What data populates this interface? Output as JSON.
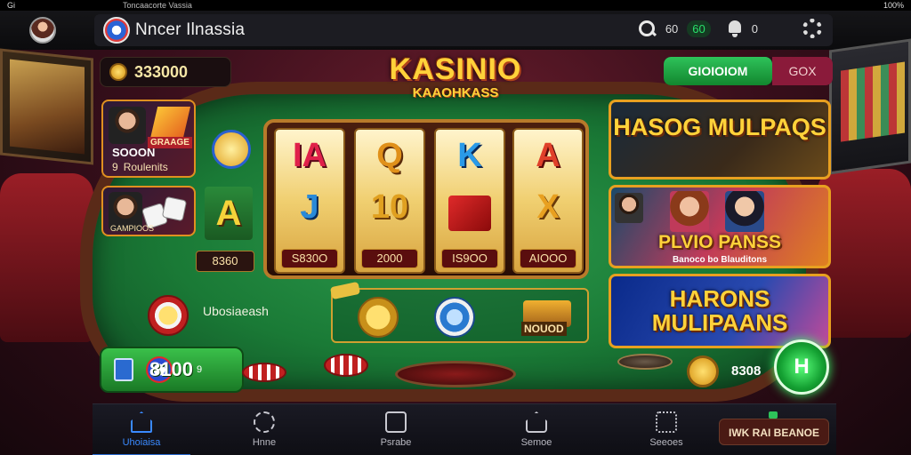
{
  "status_bar": {
    "left": "Gi",
    "center": "Toncaacorte Vassia",
    "right": "100%"
  },
  "header": {
    "title": "Nncer Ilnassia",
    "count_a": "60",
    "count_b": "60",
    "count_c": "0"
  },
  "balance": {
    "value": "333000"
  },
  "logo": {
    "line1": "KASINIO",
    "line2": "KAAOHKASS"
  },
  "tabs": {
    "primary": "GIOIOIOM",
    "secondary": "GOX"
  },
  "player_cards": [
    {
      "badge": "GRAAGE",
      "line1": "SOOON",
      "line2_icon": "9",
      "line2_text": "Roulenits"
    },
    {
      "tag": "GAMPIOOS"
    }
  ],
  "reels": [
    {
      "top": "IA",
      "mid": "J",
      "value": "S830O"
    },
    {
      "top": "Q",
      "mid": "10",
      "value": "2000"
    },
    {
      "top": "K",
      "mid": "",
      "value": "IS9OO"
    },
    {
      "top": "A",
      "mid": "X",
      "value": "AIOOO"
    }
  ],
  "left_column": {
    "symbol": "A",
    "value": "8360"
  },
  "promos": [
    {
      "title": "HASOG MULPAQS"
    },
    {
      "title": "PLVIO PANSS",
      "sub": "Banoco bo Blauditons"
    },
    {
      "title": "HARONS MULIPAANS"
    }
  ],
  "table": {
    "side_label": "Ubosiaeash",
    "treasure_label": "NOUOD",
    "bet_value": "8100",
    "bet_suffix": "9",
    "reward_value": "8308",
    "spin_label": "H"
  },
  "bottom_nav": {
    "items": [
      {
        "label": "Uhoiaisa",
        "icon": "home-icon"
      },
      {
        "label": "Hnne",
        "icon": "chip-icon"
      },
      {
        "label": "Psrabe",
        "icon": "cards-icon"
      },
      {
        "label": "Semoe",
        "icon": "house-icon"
      },
      {
        "label": "Seeoes",
        "icon": "settings-icon"
      }
    ],
    "cta": "IWK RAI BEANOE"
  },
  "colors": {
    "accent_gold": "#ffd23a",
    "spin_green": "#14a032",
    "felt_green": "#1a7a36",
    "nav_active": "#3a8aff"
  }
}
